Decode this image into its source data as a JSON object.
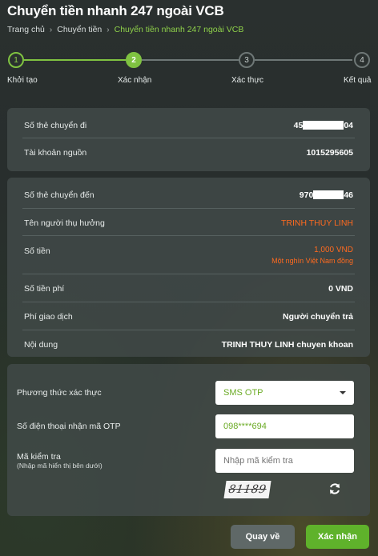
{
  "page_title": "Chuyển tiền nhanh 247 ngoài VCB",
  "breadcrumb": {
    "items": [
      "Trang chủ",
      "Chuyển tiền",
      "Chuyển tiền nhanh 247 ngoài VCB"
    ]
  },
  "stepper": {
    "steps": [
      {
        "number": "1",
        "label": "Khởi tạo",
        "state": "done"
      },
      {
        "number": "2",
        "label": "Xác nhận",
        "state": "active"
      },
      {
        "number": "3",
        "label": "Xác thực",
        "state": "todo"
      },
      {
        "number": "4",
        "label": "Kết quả",
        "state": "todo"
      }
    ]
  },
  "source": {
    "card_label": "Số thẻ chuyển đi",
    "card_prefix": "45",
    "card_suffix": "04",
    "account_label": "Tài khoản nguồn",
    "account_value": "1015295605"
  },
  "details": {
    "dest_card_label": "Số thẻ chuyển đến",
    "dest_card_prefix": "970",
    "dest_card_suffix": "46",
    "beneficiary_label": "Tên người thụ hưởng",
    "beneficiary_value": "TRINH THUY LINH",
    "amount_label": "Số tiền",
    "amount_value": "1,000 VND",
    "amount_words": "Một nghìn Việt Nam đồng",
    "fee_label": "Số tiền phí",
    "fee_value": "0 VND",
    "fee_type_label": "Phí giao dịch",
    "fee_type_value": "Người chuyển trả",
    "content_label": "Nội dung",
    "content_value": "TRINH THUY LINH chuyen khoan"
  },
  "auth": {
    "method_label": "Phương thức xác thực",
    "method_value": "SMS OTP",
    "phone_label": "Số điện thoại nhận mã OTP",
    "phone_value": "098****694",
    "captcha_label": "Mã kiểm tra",
    "captcha_hint": "(Nhập mã hiển thị bên dưới)",
    "captcha_placeholder": "Nhập mã kiểm tra",
    "captcha_image_text": "81189"
  },
  "actions": {
    "back_label": "Quay về",
    "confirm_label": "Xác nhận"
  },
  "colors": {
    "accent_green": "#7fc241",
    "link_green": "#8fd14a",
    "beneficiary_orange": "#ff6a1f",
    "card_bg": "#424a49"
  }
}
